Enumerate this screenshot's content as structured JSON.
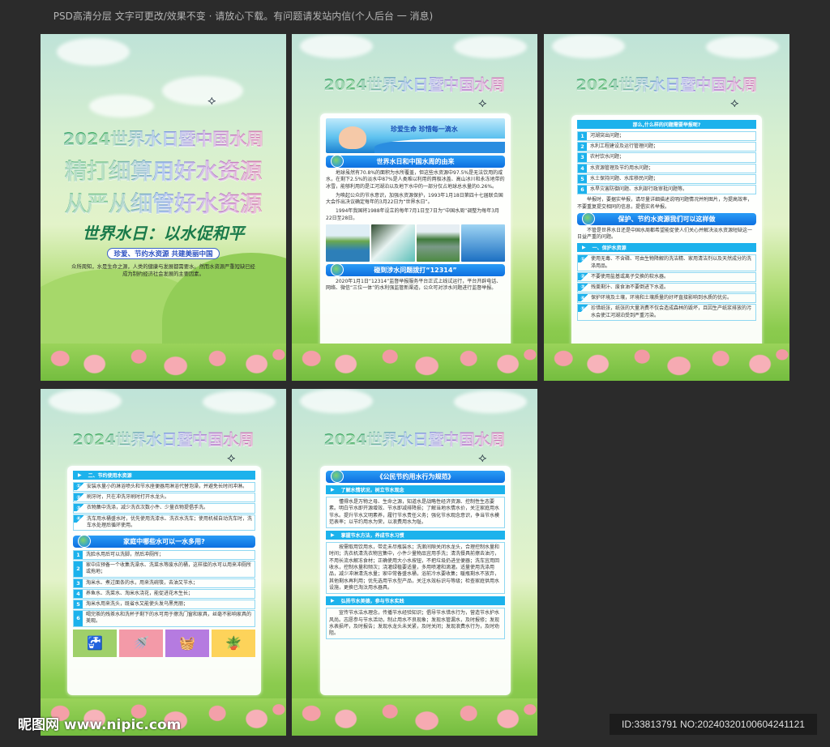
{
  "notice": "PSD高清分层 文字可更改/效果不变 · 请放心下载。有问题请发站内信(个人后台 一 消息)",
  "colors": {
    "background": "#2b2b2b",
    "section_blue": "#0d6fe0",
    "sub_cyan": "#1cb2ec"
  },
  "poster1": {
    "title_lines": [
      "2024世界水日暨中国水周",
      "精打细算用好水资源",
      "从严从细管好水资源"
    ],
    "slogan": "世界水日：以水促和平",
    "subtitle": "珍爱、节约水资源 共建美丽中国",
    "intro": "众所周知，水是生命之源，人类的健康与发展都需要水。然而水资源严重短缺已经成为制约经济社会发展的主要因素。"
  },
  "poster_title": "2024世界水日暨中国水周",
  "poster2": {
    "banner": "珍爱生命 珍惜每一滴水",
    "section1": "世界水日和中国水周的由来",
    "paras": [
      "地球虽然有70.8%的面积为水所覆盖，但这些水资源中97.5%是无法饮用的咸水，在剩下2.5%的淡水中87%是人类难以利用的两极冰盖、高山冰川和永冻地带的冰雪，能够利用的是江河湖泊以及地下水中的一部分仅占地球总水量的0.26%。",
      "为唤起公众的节水意识，加强水资源保护，1993年1月18日第四十七届联合国大会作出决议确定每年的3月22日为“世界水日”。",
      "1994年我国将1988年设立的每年7月1日至7日为“中国水周”调整为每年3月22日至28日。"
    ],
    "section2": "碰到涉水问题拨打“12314”",
    "para2": "2020年1月1日“12314”监督举报服务平台正式上线试运行，平台开辟电话、网络、微信“三位一体”的水利强监管新渠道，公众可对涉水问题进行监督举报。"
  },
  "poster3": {
    "question": "那么,什么样的问题需要举报呢?",
    "items": [
      "河湖突出问题；",
      "水利工程建设及运行管理问题；",
      "农村饮水问题；",
      "水资源管理及节约用水问题；",
      "水土保持问题、水库移民问题；",
      "水旱灾害防御问题、水利部行政审批问题等。"
    ],
    "note": "举报时，要据实举报，请尽量详细描述说明问题情况并附图片，为提高效率，不要重复提交相同的信息，提倡实名举报。",
    "section": "保护、节约水资源我们可以这样做",
    "intro": "不管是世界水日还是中国水周都希望能促使人们关心并解决淡水资源短缺这一日益严重的问题。",
    "sub": "一、保护水资源",
    "protect": [
      "使用无毒、不含磷、可由生物降解的洗洁精、家用清洁剂以及天然成分的洗涤用品。",
      "不要使用盐基或离子交换的软水器。",
      "残羹剩汁、废食油不要倒进下水道。",
      "保护环境及土壤，环境和土壤质量的好坏直接影响到水质的优劣。",
      "珍惜纸张，纸张的大量消费不仅会造成森林的毁坏，且因生产纸浆排放的污水会使江河湖泊受到严重污染。"
    ]
  },
  "poster4": {
    "sub": "二、节约使用水资源",
    "save": [
      "安装水量小的淋浴喷头和节水座便器用淋浴代替泡澡，并避免长时间冲淋。",
      "刷牙时，只在冲洗牙刷时打开水龙头。",
      "衣物集中洗涤，减少洗衣次数小件、少量衣物提倡手洗。",
      "洗车用水桶盛水时，优先使用洗漆水、洗衣水洗车；使用机械自动洗车时，洗车水处理后循环使用。"
    ],
    "section": "家庭中哪些水可以一水多用?",
    "reuse": [
      "洗脸水用后可以洗脚，然后冲厕所；",
      "家中应预备一个收集洗澡水、洗菜水等废水的桶，这样接的水可以用来冲厕所或拖地；",
      "淘米水、煮过面条的水，用来洗碗筷，去油又节水；",
      "养鱼水、洗菜水、淘米水浇花，能促进花木生长；",
      "淘米水用来洗头，既省水又能使头发乌黑亮丽；",
      "喝完茶的残茶水和洗杯子剩下的水可用于擦洗门窗和家具，丝毫不影响家具的美观。"
    ]
  },
  "poster5": {
    "section": "《公民节约用水行为规范》",
    "sub1": "了解水情状况，树立节水观念",
    "para1": "懂得水是万物之母、生命之源，知道水是战略性经济资源、控制性生态要素。明白节水即开源增效、节水即减排降损；了解当地水情水价，关注家庭用水节水。提升节水文明素养，履行节水责任义务；强化节水观念意识，争当节水模范表率；以节约用水为荣，以浪费用水为耻。",
    "sub2": "掌握节水方法，养成节水习惯",
    "para2": "按需取用饮用水，带走未尽瓶装水；洗漱间隙关闭水龙头，合理控制水量和时间；洗衣机清洗衣物宜集中，小件少量物品宜用手洗；清洗餐具前擦去油污，不用长流水解冻食材；正确使用大小水按钮，不把垃圾扔进坐便器；洗车宜用回收水，控制水量和频次；浇灌绿植要适量，多用喷灌和滴灌。适量使用洗涤用品，减少冲淋清洗水量；家中常备盛水桶，浴前冷水要收集；暖瓶剩水不放弃，其他剩水再利用；优先选用节水型产品，关注水效标识与等级；检查家庭供用水设施，更换已淘汰用水器具。",
    "sub3": "弘扬节水美德，参与节水实践",
    "para3": "宣传节水洁水理念，传播节水经验知识；倡导节水惜水行为，营造节水护水风尚。志愿参与节水活动，制止用水不良现象；发现水管漏水，及时报修；发现水表损坏，及时报告；发现水龙头未关紧，及时关闭；发现浪费水行为，及时劝阻。"
  },
  "watermark": "昵图网 www.nipic.com",
  "id_text": "ID:33813791 NO:20240320100604241121"
}
